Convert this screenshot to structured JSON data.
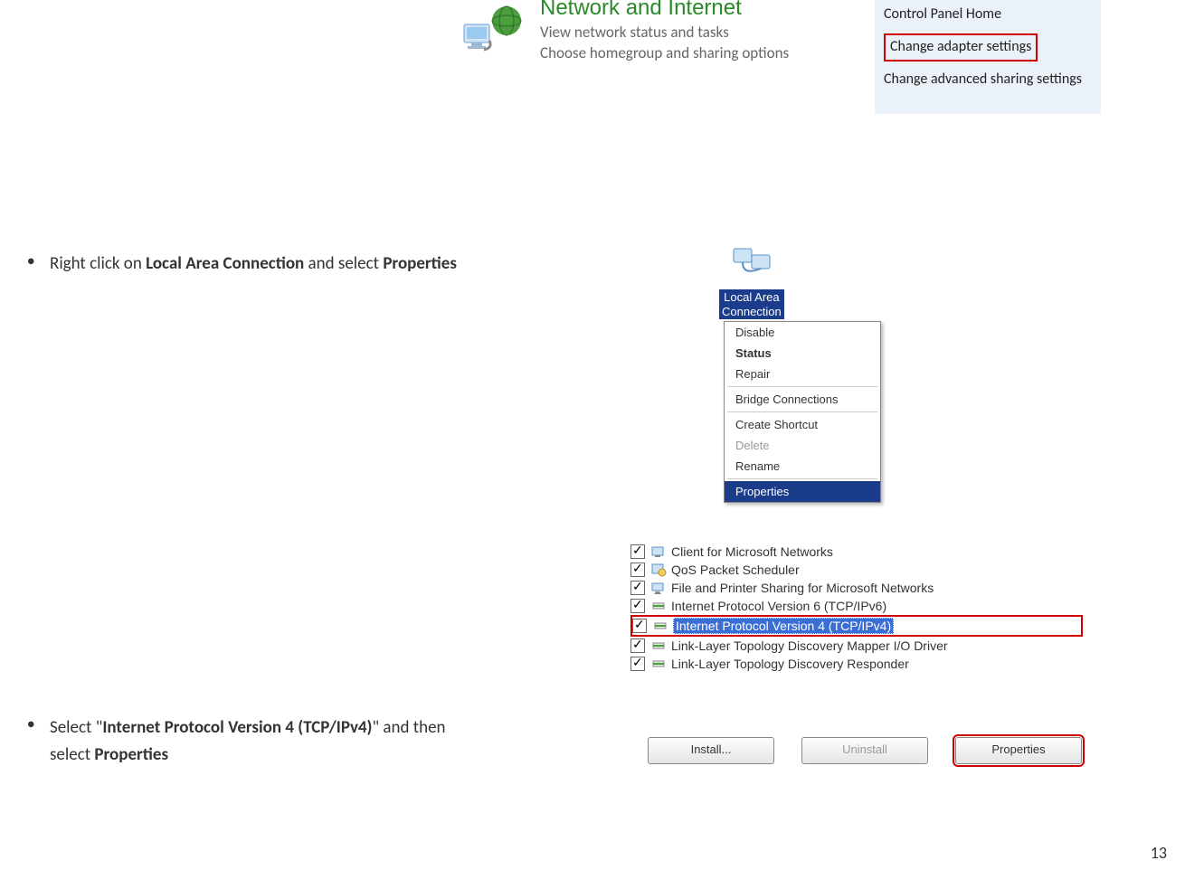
{
  "controlPanel": {
    "title": "Network and Internet",
    "sub1": "View network status and tasks",
    "sub2": "Choose homegroup and sharing options"
  },
  "sidebar": {
    "item1": "Control Panel Home",
    "item2": "Change adapter settings",
    "item3": "Change advanced sharing settings"
  },
  "instructions": {
    "line1_pre": "Right click on ",
    "line1_bold1": "Local Area Connection",
    "line1_mid": " and select ",
    "line1_bold2": "Properties",
    "line2_pre": "Select \"",
    "line2_bold1": "Internet Protocol Version 4 (TCP/IPv4)",
    "line2_mid": "\" and then ",
    "line2_cont": "select ",
    "line2_bold2": "Properties"
  },
  "lac": {
    "line1": "Local Area",
    "line2": "Connection"
  },
  "contextMenu": {
    "disable": "Disable",
    "status": "Status",
    "repair": "Repair",
    "bridge": "Bridge Connections",
    "shortcut": "Create Shortcut",
    "delete": "Delete",
    "rename": "Rename",
    "properties": "Properties"
  },
  "propsList": [
    {
      "label": "Client for Microsoft Networks",
      "checked": true,
      "icon": "client"
    },
    {
      "label": "QoS Packet Scheduler",
      "checked": true,
      "icon": "qos"
    },
    {
      "label": "File and Printer Sharing for Microsoft Networks",
      "checked": true,
      "icon": "share"
    },
    {
      "label": "Internet Protocol Version 6 (TCP/IPv6)",
      "checked": true,
      "icon": "proto"
    },
    {
      "label": "Internet Protocol Version 4 (TCP/IPv4)",
      "checked": true,
      "icon": "proto",
      "selected": true,
      "red": true
    },
    {
      "label": "Link-Layer Topology Discovery Mapper I/O Driver",
      "checked": true,
      "icon": "proto"
    },
    {
      "label": "Link-Layer Topology Discovery Responder",
      "checked": true,
      "icon": "proto"
    }
  ],
  "buttons": {
    "install": "Install...",
    "uninstall": "Uninstall",
    "properties": "Properties"
  },
  "pageNumber": "13"
}
